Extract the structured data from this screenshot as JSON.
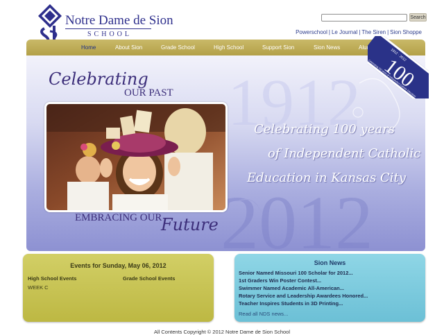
{
  "header": {
    "logo_name": "Notre Dame de Sion",
    "logo_school": "SCHOOL",
    "search_button": "Search",
    "top_links": [
      "Powerschool",
      "Le Journal",
      "The Siren",
      "Sion Shoppe"
    ]
  },
  "nav": {
    "items": [
      "Home",
      "About Sion",
      "Grade School",
      "High School",
      "Support Sion",
      "Sion News",
      "Alumni"
    ],
    "active": "Home"
  },
  "badge": {
    "number": "100",
    "years_text": "1912 · 2012",
    "caption": "Celebrating 100 years of Independent Catholic Education"
  },
  "hero": {
    "celebrating": "Celebrating",
    "our_past": "OUR PAST",
    "embracing": "EMBRACING OUR",
    "future": "Future",
    "line1": "Celebrating 100 years",
    "line2": "of Independent Catholic",
    "line3": "Education in Kansas City",
    "year_start": "1912",
    "year_end": "2012"
  },
  "events": {
    "title": "Events for Sunday, May 06, 2012",
    "high_school_heading": "High School Events",
    "grade_school_heading": "Grade School Events",
    "high_school_items": [
      "WEEK C"
    ]
  },
  "news": {
    "title": "Sion News",
    "items": [
      "Senior Named Missouri 100 Scholar for 2012...",
      "1st Graders Win Poster Contest...",
      "Swimmer Named Academic All-American...",
      "Rotary Service and Leadership Awardees Honored...",
      "Teacher Inspires Students in 3D Printing..."
    ],
    "read_all": "Read all NDS news..."
  },
  "footer": "All Contents Copyright © 2012 Notre Dame de Sion School",
  "colors": {
    "brand_blue": "#2e2f8c",
    "nav_gold": "#bfae58",
    "events_green": "#c9c555",
    "news_cyan": "#7fcde0",
    "hero_purple": "#8d91d2"
  }
}
